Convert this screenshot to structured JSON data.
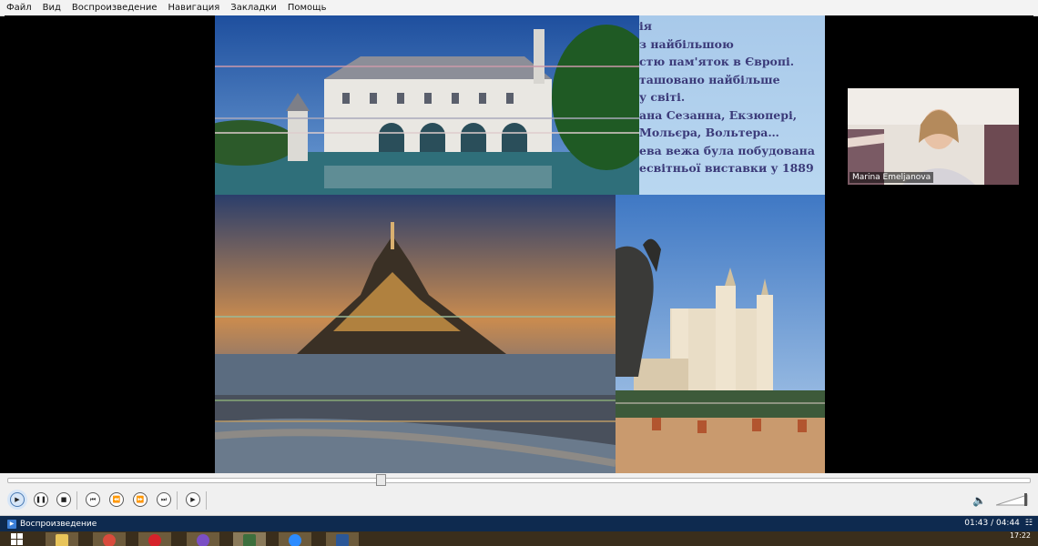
{
  "menu": {
    "items": [
      "Файл",
      "Вид",
      "Воспроизведение",
      "Навигация",
      "Закладки",
      "Помощь"
    ]
  },
  "slide": {
    "text_lines": [
      "ія",
      "з найбільшою",
      "стю пам'яток в Європі.",
      "ташовано найбільше",
      "у світі.",
      "ана Сезанна, Екзюпері,",
      "Мольєра, Вольтера…",
      "ева вежа була побудована",
      "есвітньої виставки у 1889"
    ],
    "photos": [
      {
        "name": "chateau-photo",
        "description_icon": "castle-icon"
      },
      {
        "name": "mont-saint-michel-photo",
        "description_icon": "abbey-icon"
      },
      {
        "name": "lyon-basilica-photo",
        "description_icon": "basilica-icon"
      }
    ]
  },
  "camera": {
    "participant_name": "Marina Emeljanova"
  },
  "playback": {
    "position_fraction": 0.365,
    "controls": [
      "play-icon",
      "pause-icon",
      "stop-icon",
      "previous-icon",
      "rewind-icon",
      "forward-icon",
      "next-icon",
      "frame-step-icon"
    ],
    "volume_icon": "speaker-icon"
  },
  "status": {
    "label": "Воспроизведение",
    "time": "01:43 / 04:44"
  },
  "taskbar": {
    "apps": [
      {
        "name": "start-icon",
        "color": "#ffffff"
      },
      {
        "name": "explorer-icon",
        "color": "#e8c45a"
      },
      {
        "name": "chrome-icon",
        "color": "#d94b3c"
      },
      {
        "name": "opera-icon",
        "color": "#d6222a"
      },
      {
        "name": "viber-icon",
        "color": "#7b4fc4"
      },
      {
        "name": "media-player-icon",
        "color": "#3d6f3d"
      },
      {
        "name": "zoom-icon",
        "color": "#2d8cff"
      },
      {
        "name": "word-icon",
        "color": "#2b5797"
      }
    ],
    "clock_time": "17:22"
  },
  "colors": {
    "slide_text": "#3b3a79",
    "status_bar": "#0e2a4f"
  }
}
